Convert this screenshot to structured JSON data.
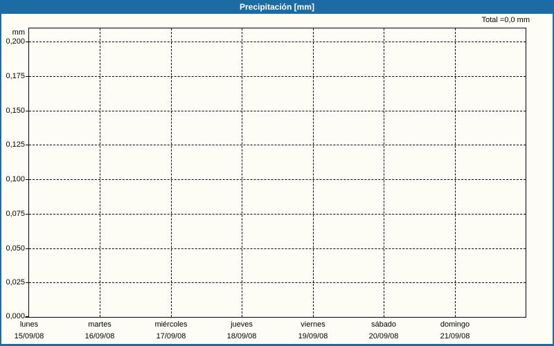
{
  "window": {
    "title": "Precipitación [mm]"
  },
  "header": {
    "total_label": "Total =0,0 mm"
  },
  "colors": {
    "titlebar_blue": "#1d6ba3",
    "frame_border_blue": "#1d6ba3",
    "background_ivory": "#fdfdf5",
    "grid_black": "#000000",
    "text_black": "#000000",
    "title_text_white": "#ffffff"
  },
  "chart_data": {
    "type": "line",
    "title": "Precipitación [mm]",
    "xlabel": "",
    "ylabel": "mm",
    "ylim": [
      0,
      0.2
    ],
    "grid": "dashed",
    "legend_position": "none",
    "y_tick_labels": [
      "0,200",
      "0,175",
      "0,150",
      "0,125",
      "0,100",
      "0,075",
      "0,050",
      "0,025",
      "0,000"
    ],
    "y_tick_values": [
      0.2,
      0.175,
      0.15,
      0.125,
      0.1,
      0.075,
      0.05,
      0.025,
      0.0
    ],
    "categories_day": [
      "lunes",
      "martes",
      "miércoles",
      "jueves",
      "viernes",
      "sábado",
      "domingo"
    ],
    "categories_date": [
      "15/09/08",
      "16/09/08",
      "17/09/08",
      "18/09/08",
      "19/09/08",
      "20/09/08",
      "21/09/08"
    ],
    "series": [
      {
        "name": "Precipitación",
        "values": [
          0,
          0,
          0,
          0,
          0,
          0,
          0
        ]
      }
    ],
    "total_value_mm": "0,0"
  }
}
